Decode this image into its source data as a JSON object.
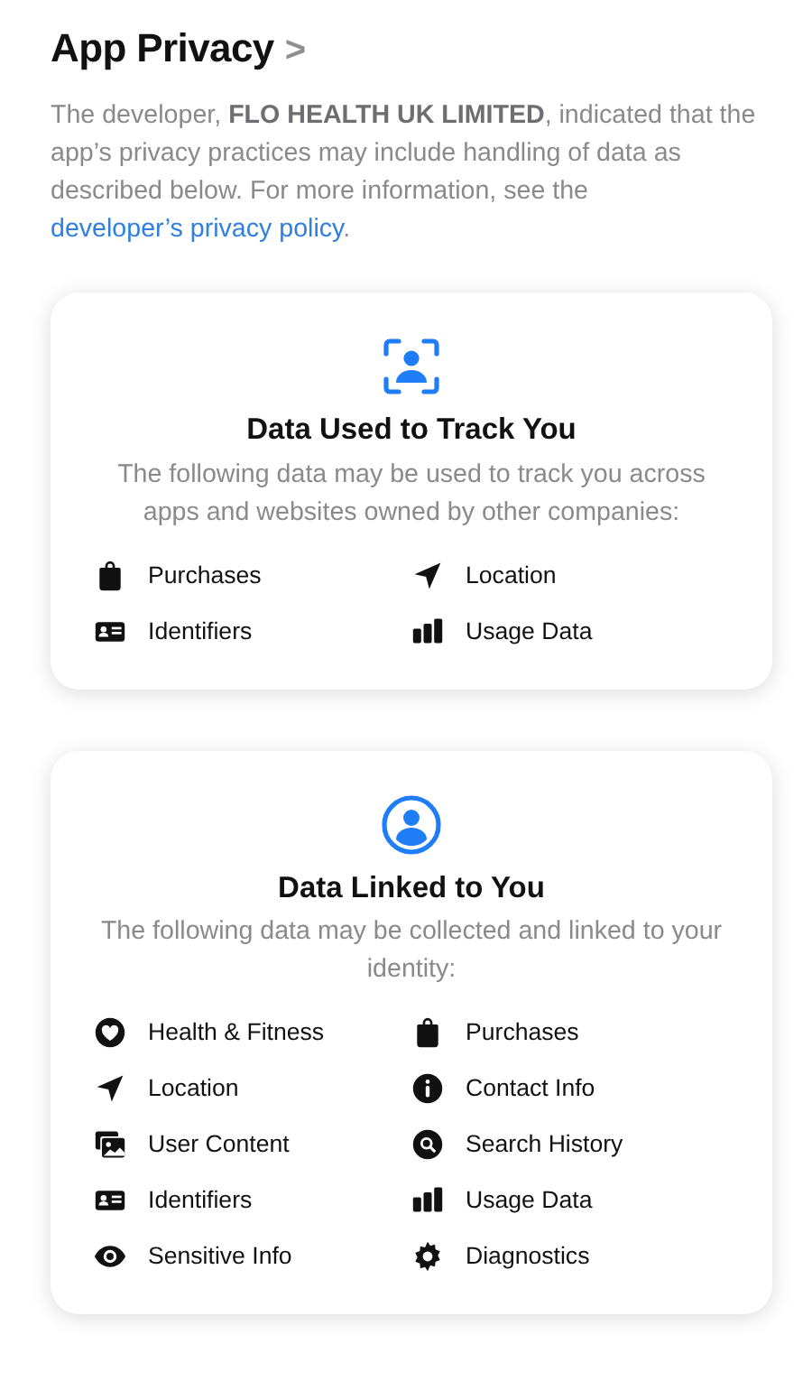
{
  "header": {
    "title": "App Privacy",
    "chevron": ">"
  },
  "intro": {
    "text": "The developer, **FLO HEALTH UK LIMITED**, indicated that the app’s privacy practices may include handling of data as described below. For more information, see the",
    "link": "developer’s privacy policy",
    "end": "."
  },
  "cards": [
    {
      "kind": "tracking",
      "title": "Data Used to Track You",
      "description": "The following data may be used to track you across apps and websites owned by other companies:",
      "items": [
        {
          "kind": "bag",
          "label": "Purchases"
        },
        {
          "kind": "arrow",
          "label": "Location"
        },
        {
          "kind": "idcard",
          "label": "Identifiers"
        },
        {
          "kind": "bars",
          "label": "Usage Data"
        }
      ]
    },
    {
      "kind": "linked",
      "title": "Data Linked to You",
      "description": "The following data may be collected and linked to your identity:",
      "items": [
        {
          "kind": "heart",
          "label": "Health & Fitness"
        },
        {
          "kind": "bag",
          "label": "Purchases"
        },
        {
          "kind": "arrow",
          "label": "Location"
        },
        {
          "kind": "info",
          "label": "Contact Info"
        },
        {
          "kind": "photos",
          "label": "User Content"
        },
        {
          "kind": "search",
          "label": "Search History"
        },
        {
          "kind": "idcard",
          "label": "Identifiers"
        },
        {
          "kind": "bars",
          "label": "Usage Data"
        },
        {
          "kind": "eye",
          "label": "Sensitive Info"
        },
        {
          "kind": "gear",
          "label": "Diagnostics"
        }
      ]
    }
  ]
}
